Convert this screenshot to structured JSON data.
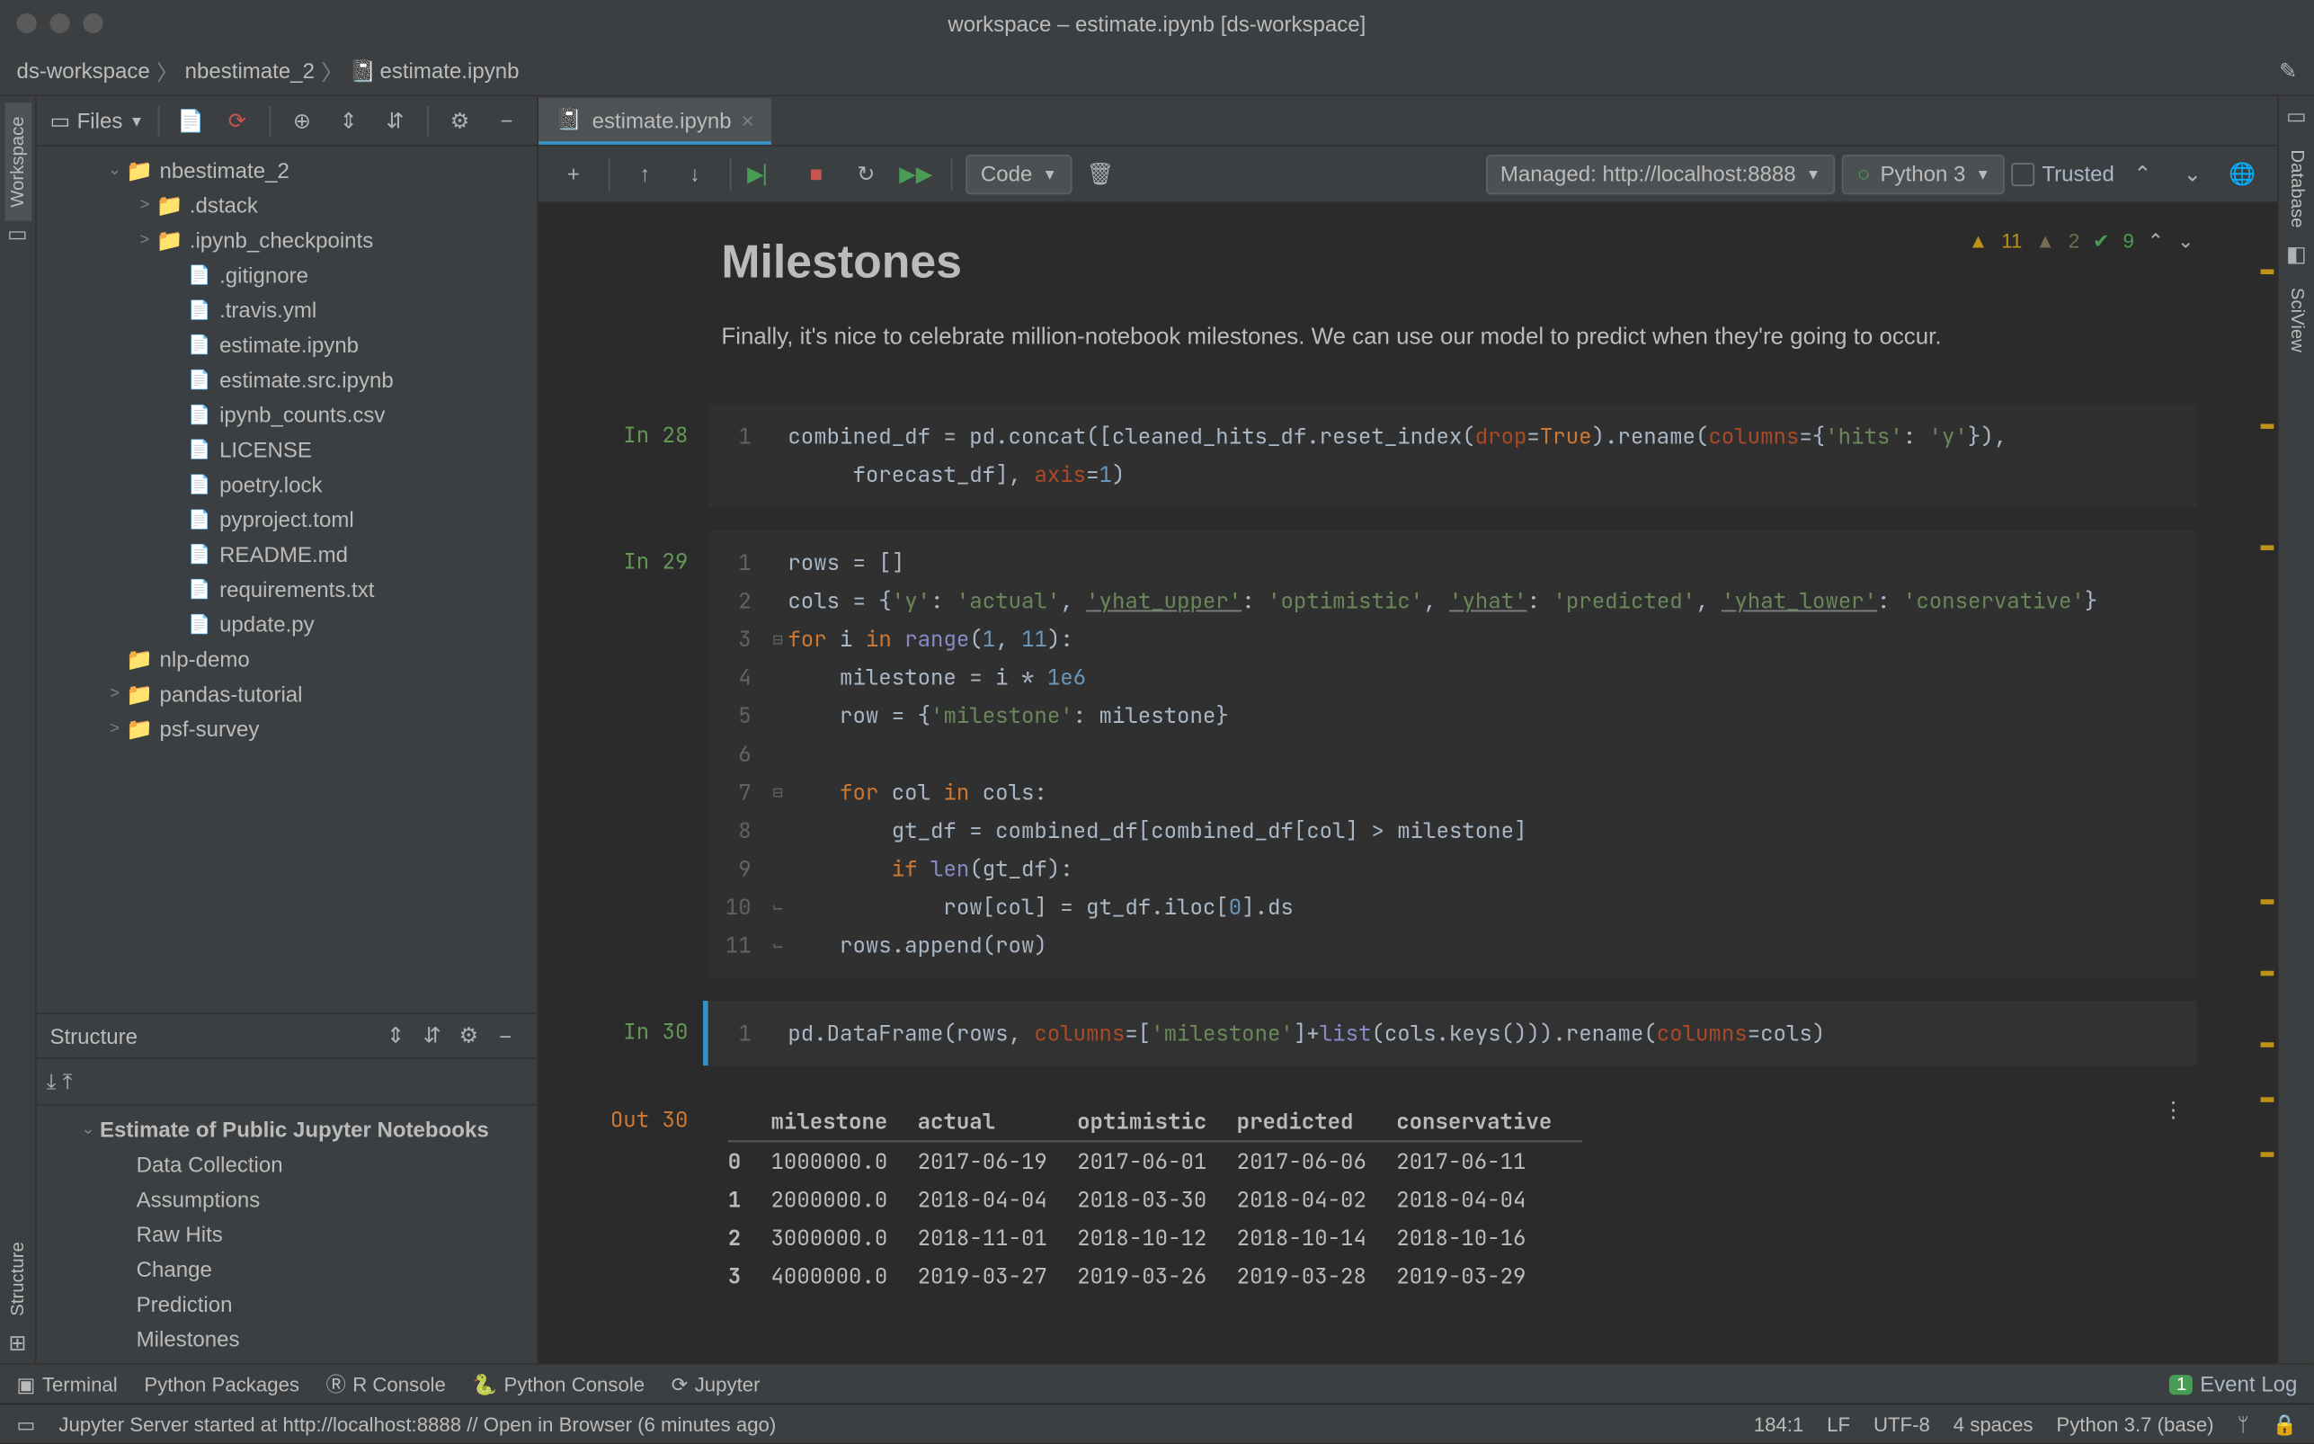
{
  "window": {
    "title": "workspace – estimate.ipynb [ds-workspace]"
  },
  "breadcrumb": {
    "project": "ds-workspace",
    "folder": "nbestimate_2",
    "file": "estimate.ipynb"
  },
  "left_gutter": {
    "workspace": "Workspace",
    "structure": "Structure"
  },
  "right_gutter": {
    "database": "Database",
    "sciview": "SciView"
  },
  "files_panel": {
    "title": "Files",
    "tree": {
      "root_folder": "nbestimate_2",
      "items": [
        {
          "type": "folder",
          "name": ".dstack",
          "depth": 2,
          "arrow": ">"
        },
        {
          "type": "folder",
          "name": ".ipynb_checkpoints",
          "depth": 2,
          "arrow": ">"
        },
        {
          "type": "file",
          "name": ".gitignore",
          "depth": 3,
          "icon": "txt"
        },
        {
          "type": "file",
          "name": ".travis.yml",
          "depth": 3,
          "icon": "yml"
        },
        {
          "type": "file",
          "name": "estimate.ipynb",
          "depth": 3,
          "icon": "ipynb"
        },
        {
          "type": "file",
          "name": "estimate.src.ipynb",
          "depth": 3,
          "icon": "ipynb"
        },
        {
          "type": "file",
          "name": "ipynb_counts.csv",
          "depth": 3,
          "icon": "csv"
        },
        {
          "type": "file",
          "name": "LICENSE",
          "depth": 3,
          "icon": "txt"
        },
        {
          "type": "file",
          "name": "poetry.lock",
          "depth": 3,
          "icon": "txt"
        },
        {
          "type": "file",
          "name": "pyproject.toml",
          "depth": 3,
          "icon": "toml"
        },
        {
          "type": "file",
          "name": "README.md",
          "depth": 3,
          "icon": "md"
        },
        {
          "type": "file",
          "name": "requirements.txt",
          "depth": 3,
          "icon": "txt"
        },
        {
          "type": "file",
          "name": "update.py",
          "depth": 3,
          "icon": "py"
        }
      ],
      "siblings": [
        {
          "name": "nlp-demo",
          "arrow": ""
        },
        {
          "name": "pandas-tutorial",
          "arrow": ">"
        },
        {
          "name": "psf-survey",
          "arrow": ">"
        }
      ]
    }
  },
  "structure_panel": {
    "title": "Structure",
    "root": "Estimate of Public Jupyter Notebooks",
    "items": [
      "Data Collection",
      "Assumptions",
      "Raw Hits",
      "Change",
      "Prediction",
      "Milestones"
    ]
  },
  "editor": {
    "tab": {
      "label": "estimate.ipynb"
    },
    "toolbar": {
      "cell_type": "Code",
      "managed": "Managed: http://localhost:8888",
      "interpreter": "Python 3",
      "trusted": "Trusted"
    },
    "diagnostics": {
      "warn": "11",
      "weak": "2",
      "ok": "9"
    },
    "markdown": {
      "heading": "Milestones",
      "body": "Finally, it's nice to celebrate million-notebook milestones. We can use our model to predict when they're going to occur."
    },
    "cells": {
      "in28": {
        "prompt": "In 28",
        "line1": "combined_df = pd.concat([cleaned_hits_df.reset_index(",
        "line1b": ").rename(",
        "line1c": "={",
        "line1d": ": ",
        "line1e": "}),",
        "line2": "     forecast_df], ",
        "line2b": "=",
        "line2c": ")"
      },
      "in29": {
        "prompt": "In 29"
      },
      "in30": {
        "prompt": "In 30"
      },
      "out30": {
        "prompt": "Out 30"
      }
    },
    "code29": {
      "l1": "rows = []",
      "l2a": "cols = {",
      "l2y": "'y'",
      "l2b": ": ",
      "l2actual": "'actual'",
      "l2c": ", ",
      "l2yu": "'yhat_upper'",
      "l2d": ": ",
      "l2opt": "'optimistic'",
      "l2e": ", ",
      "l2yh": "'yhat'",
      "l2f": ": ",
      "l2pred": "'predicted'",
      "l2g": ", ",
      "l2yl": "'yhat_lower'",
      "l2h": ": ",
      "l2cons": "'conservative'",
      "l2i": "}",
      "l3a": "for",
      "l3b": " i ",
      "l3c": "in",
      "l3d": " ",
      "l3e": "range",
      "l3f": "(",
      "l3g": "1",
      "l3h": ", ",
      "l3i": "11",
      "l3j": "):",
      "l4a": "    milestone = i * ",
      "l4b": "1e6",
      "l5a": "    row = {",
      "l5b": "'milestone'",
      "l5c": ": milestone}",
      "l7a": "    ",
      "l7b": "for",
      "l7c": " col ",
      "l7d": "in",
      "l7e": " cols:",
      "l8": "        gt_df = combined_df[combined_df[col] > milestone]",
      "l9a": "        ",
      "l9b": "if",
      "l9c": " ",
      "l9d": "len",
      "l9e": "(gt_df):",
      "l10a": "            row[col] = gt_df.iloc[",
      "l10b": "0",
      "l10c": "].ds",
      "l11": "    rows.append(row)"
    },
    "code30": {
      "a": "pd.DataFrame(rows, ",
      "b": "columns",
      "c": "=[",
      "d": "'milestone'",
      "e": "]+",
      "f": "list",
      "g": "(cols.keys())).rename(",
      "h": "columns",
      "i": "=cols)"
    },
    "output_table": {
      "headers": [
        "",
        "milestone",
        "actual",
        "optimistic",
        "predicted",
        "conservative"
      ],
      "rows": [
        [
          "0",
          "1000000.0",
          "2017-06-19",
          "2017-06-01",
          "2017-06-06",
          "2017-06-11"
        ],
        [
          "1",
          "2000000.0",
          "2018-04-04",
          "2018-03-30",
          "2018-04-02",
          "2018-04-04"
        ],
        [
          "2",
          "3000000.0",
          "2018-11-01",
          "2018-10-12",
          "2018-10-14",
          "2018-10-16"
        ],
        [
          "3",
          "4000000.0",
          "2019-03-27",
          "2019-03-26",
          "2019-03-28",
          "2019-03-29"
        ]
      ]
    }
  },
  "bottom_tabs": {
    "terminal": "Terminal",
    "pypackages": "Python Packages",
    "rconsole": "R Console",
    "pyconsole": "Python Console",
    "jupyter": "Jupyter",
    "event_badge": "1",
    "event_log": "Event Log"
  },
  "status": {
    "message": "Jupyter Server started at http://localhost:8888 // Open in Browser (6 minutes ago)",
    "pos": "184:1",
    "eol": "LF",
    "enc": "UTF-8",
    "indent": "4 spaces",
    "interp": "Python 3.7 (base)"
  },
  "kw": {
    "drop": "drop",
    "true": "True",
    "columns": "columns",
    "hits": "'hits'",
    "y": "'y'",
    "axis": "axis",
    "one": "1"
  }
}
